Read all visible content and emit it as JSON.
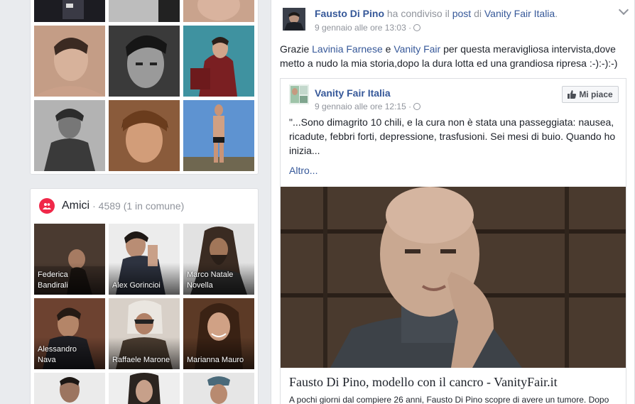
{
  "photos": {
    "tiles": [
      {
        "name": "photo-1"
      },
      {
        "name": "photo-2"
      },
      {
        "name": "photo-3"
      },
      {
        "name": "photo-4"
      },
      {
        "name": "photo-5"
      },
      {
        "name": "photo-6"
      },
      {
        "name": "photo-7"
      },
      {
        "name": "photo-8"
      },
      {
        "name": "photo-9"
      }
    ]
  },
  "friends": {
    "title": "Amici",
    "count": "· 4589 (1 in comune)",
    "icon": "friends-icon",
    "accent": "#f02849",
    "items": [
      {
        "line1": "Federica",
        "line2": "Bandirali"
      },
      {
        "line1": "Alex Gorincioi",
        "line2": ""
      },
      {
        "line1": "Marco Natale",
        "line2": "Novella"
      },
      {
        "line1": "Alessandro",
        "line2": "Nava"
      },
      {
        "line1": "Raffaele Marone",
        "line2": ""
      },
      {
        "line1": "Marianna Mauro",
        "line2": ""
      }
    ]
  },
  "post": {
    "author": "Fausto Di Pino",
    "shared_text_1": " ha condiviso il ",
    "shared_link": "post",
    "shared_text_2": " di ",
    "page": "Vanity Fair Italia",
    "page_suffix": ".",
    "date": "9 gennaio alle ore 13:03 ·",
    "text_1": "Grazie ",
    "mention_1": "Lavinia Farnese",
    "text_2": " e ",
    "mention_2": "Vanity Fair",
    "text_3": " per questa meravigliosa intervista,dove metto a nudo la mia storia,dopo la dura lotta ed una grandiosa ripresa :-):-):-)"
  },
  "shared": {
    "page": "Vanity Fair Italia",
    "date": "9 gennaio alle ore 12:15 ·",
    "like_label": "Mi piace",
    "text": "\"...Sono dimagrito 10 chili, e la cura non è stata una passeggiata: nausea, ricadute, febbri forti, depressione, trasfusioni. Sei mesi di buio. Quando ho inizia...",
    "more": "Altro...",
    "link_title": "Fausto Di Pino, modello con il cancro - VanityFair.it",
    "link_desc": "A pochi giorni dal compiere 26 anni, Fausto Di Pino scopre di avere un tumore. Dopo"
  },
  "colors": {
    "link": "#365899",
    "meta": "#90949c",
    "bg": "#e9ebee"
  }
}
